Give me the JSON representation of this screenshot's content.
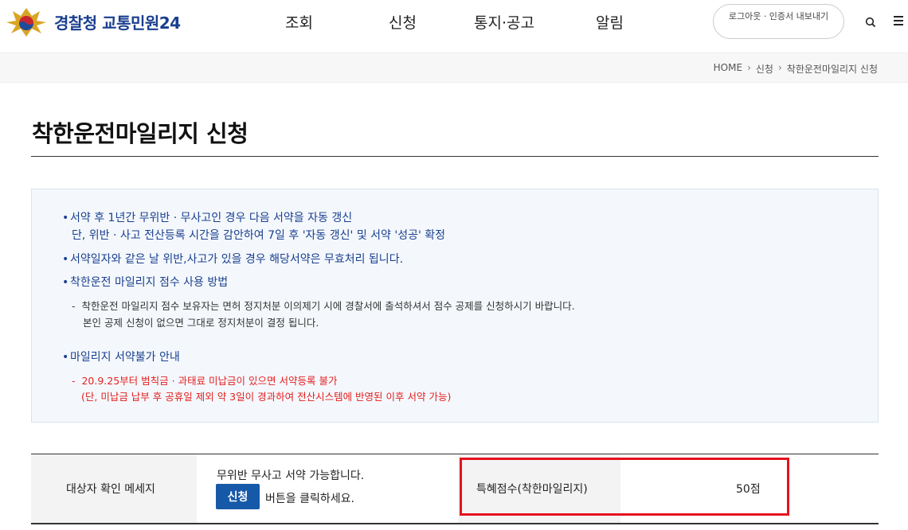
{
  "header": {
    "logo_text": "경찰청 교통민원24",
    "nav": [
      "조회",
      "신청",
      "통지·공고",
      "알림"
    ],
    "auth": {
      "logout": "로그아웃",
      "cert_export": "· 인증서 내보내기"
    },
    "icons": {
      "search": "search-icon",
      "menu": "hamburger-menu-icon",
      "logo": "police-emblem-icon"
    }
  },
  "breadcrumb": [
    "HOME",
    "신청",
    "착한운전마일리지 신청"
  ],
  "page": {
    "title": "착한운전마일리지 신청"
  },
  "info": {
    "bullet1_line1": "서약 후 1년간 무위반 · 무사고인 경우 다음 서약을 자동 갱신",
    "bullet1_line2": "단, 위반 · 사고 전산등록 시간을 감안하여 7일 후 '자동 갱신' 및 서약 '성공' 확정",
    "bullet2": "서약일자와 같은 날 위반,사고가 있을 경우 해당서약은 무효처리 됩니다.",
    "bullet3": "착한운전 마일리지 점수 사용 방법",
    "bullet3_sub1": "착한운전 마일리지 점수 보유자는 면허 정지처분 이의제기 시에 경찰서에 출석하셔서 점수 공제를 신청하시기 바랍니다.",
    "bullet3_sub2": "본인 공제 신청이 없으면 그대로 정지처분이 결정 됩니다.",
    "bullet4": "마일리지 서약불가 안내",
    "bullet4_sub1": "20.9.25부터 범칙금 · 과태료 미납금이 있으면 서약등록 불가",
    "bullet4_sub2": "(단, 미납금 납부 후 공휴일 제외 약 3일이 경과하여 전산시스템에 반영된 이후 서약 가능)",
    "bullet_char": "•",
    "dash_char": "-"
  },
  "result": {
    "label_message": "대상자 확인 메세지",
    "message_line1": "무위반 무사고 서약 가능합니다.",
    "apply_button": "신청",
    "message_line2": "버튼을 클릭하세요.",
    "label_score": "특혜점수(착한마일리지)",
    "score": "50점"
  },
  "colors": {
    "brand_blue": "#1a3f8f",
    "button_blue": "#1659a8",
    "warning_red": "#e52020",
    "highlight_red": "#e5121e"
  }
}
